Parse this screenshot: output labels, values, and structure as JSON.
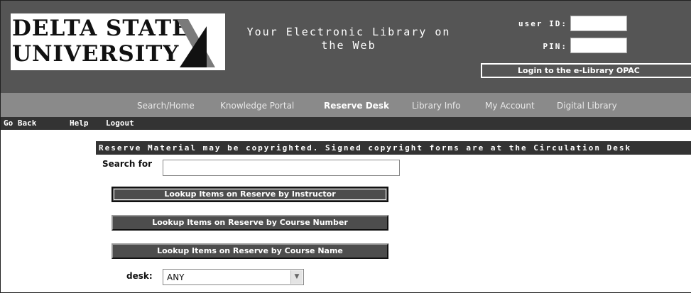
{
  "header": {
    "logo_line1": "DELTA STATE",
    "logo_line2": "UNIVERSITY",
    "tagline": "Your Electronic Library on the Web",
    "user_id_label": "user ID:",
    "pin_label": "PIN:",
    "login_button": "Login to the e-Library OPAC"
  },
  "nav": {
    "items": [
      {
        "label": "Search/Home",
        "active": false
      },
      {
        "label": "Knowledge Portal",
        "active": false
      },
      {
        "label": "Reserve Desk",
        "active": true
      },
      {
        "label": "Library Info",
        "active": false
      },
      {
        "label": "My Account",
        "active": false
      },
      {
        "label": "Digital Library",
        "active": false
      }
    ]
  },
  "subnav": {
    "items": [
      "Go Back",
      "Help",
      "Logout"
    ]
  },
  "main": {
    "banner": "Reserve Material may be copyrighted. Signed copyright forms are at the Circulation Desk",
    "search_label": "Search for",
    "search_value": "",
    "buttons": [
      "Lookup Items on Reserve by Instructor",
      "Lookup Items on Reserve by Course Number",
      "Lookup Items on Reserve by Course Name"
    ],
    "desk_label": "desk:",
    "desk_value": "ANY"
  },
  "colors": {
    "header_bg": "#555555",
    "nav_bg": "#8a8a8a",
    "subnav_bg": "#333333",
    "button_bg": "#4d4d4d"
  }
}
